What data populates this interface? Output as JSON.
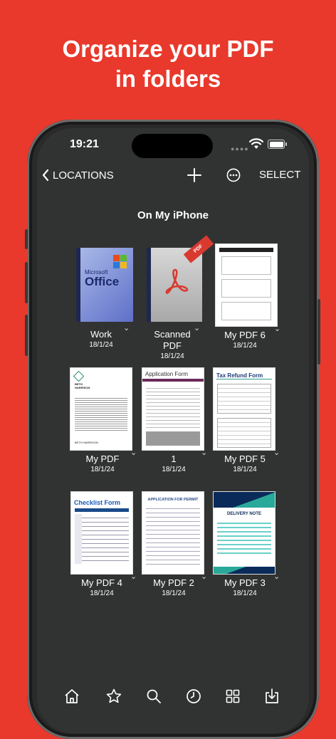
{
  "headline": {
    "line1": "Organize your PDF",
    "line2": "in folders"
  },
  "status": {
    "time": "19:21"
  },
  "nav": {
    "back_label": "LOCATIONS",
    "select_label": "SELECT"
  },
  "folder": {
    "title": "On My iPhone"
  },
  "items": [
    {
      "name": "Work",
      "date": "18/1/24",
      "kind": "folder-office"
    },
    {
      "name": "Scanned PDF",
      "name_line1": "Scanned",
      "name_line2": "PDF",
      "date": "18/1/24",
      "kind": "folder-pdf"
    },
    {
      "name": "My PDF 6",
      "date": "18/1/24",
      "kind": "document"
    },
    {
      "name": "My PDF",
      "date": "18/1/24",
      "kind": "document"
    },
    {
      "name": "1",
      "date": "18/1/24",
      "kind": "document",
      "doc_title": "Application Form"
    },
    {
      "name": "My PDF 5",
      "date": "18/1/24",
      "kind": "document",
      "doc_title": "Tax Refund Form"
    },
    {
      "name": "My PDF 4",
      "date": "18/1/24",
      "kind": "document",
      "doc_title": "Checklist Form"
    },
    {
      "name": "My PDF 2",
      "date": "18/1/24",
      "kind": "document",
      "doc_title": "APPLICATION FOR PERMIT"
    },
    {
      "name": "My PDF 3",
      "date": "18/1/24",
      "kind": "document",
      "doc_title": "DELIVERY NOTE"
    }
  ],
  "thumb_text": {
    "office_brand": "Microsoft",
    "office_word": "Office",
    "pdf_badge": "PDF",
    "cv_name": "BETH\nHARRISON",
    "cv_signature": "BETH HARRISON"
  },
  "tabbar": [
    {
      "icon": "home-icon"
    },
    {
      "icon": "star-icon"
    },
    {
      "icon": "search-icon"
    },
    {
      "icon": "clock-icon"
    },
    {
      "icon": "grid-icon"
    },
    {
      "icon": "import-icon"
    }
  ],
  "colors": {
    "background": "#e8392c",
    "screen": "#313232",
    "accent": "#ffffff"
  }
}
